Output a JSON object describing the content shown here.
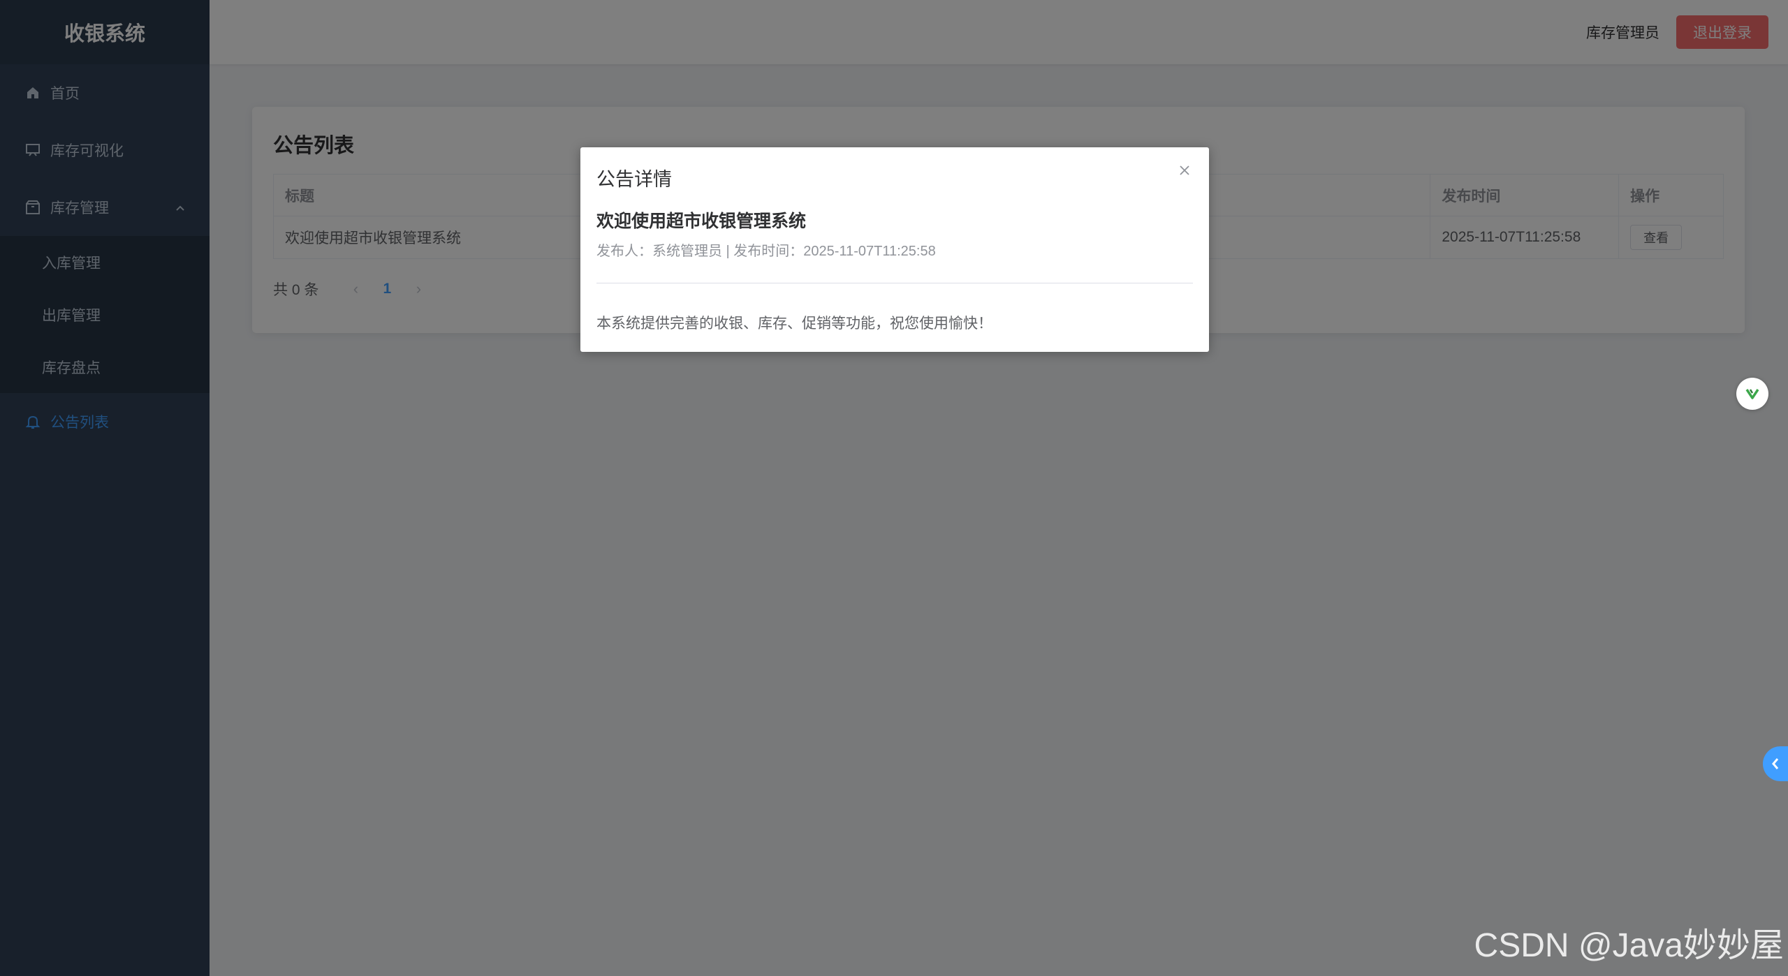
{
  "sidebar": {
    "brand": "收银系统",
    "items": [
      {
        "label": "首页",
        "icon": "home-icon"
      },
      {
        "label": "库存可视化",
        "icon": "chart-board-icon"
      },
      {
        "label": "库存管理",
        "icon": "box-icon",
        "expanded": true
      },
      {
        "label": "入库管理"
      },
      {
        "label": "出库管理"
      },
      {
        "label": "库存盘点"
      },
      {
        "label": "公告列表",
        "icon": "bell-icon",
        "active": true
      }
    ]
  },
  "header": {
    "user": "库存管理员",
    "logout_label": "退出登录"
  },
  "card": {
    "title": "公告列表",
    "columns": [
      "标题",
      "发布时间",
      "操作"
    ],
    "rows": [
      {
        "title": "欢迎使用超市收银管理系统",
        "time": "2025-11-07T11:25:58",
        "action": "查看"
      }
    ],
    "pagination": {
      "total": "共 0 条",
      "current_page": "1"
    }
  },
  "dialog": {
    "title": "公告详情",
    "notice_title": "欢迎使用超市收银管理系统",
    "meta": "发布人：系统管理员 | 发布时间：2025-11-07T11:25:58",
    "content": "本系统提供完善的收银、库存、促销等功能，祝您使用愉快！"
  },
  "colors": {
    "sidebar_bg": "#304156",
    "accent": "#409eff",
    "danger": "#f56c6c"
  },
  "watermark": "CSDN @Java妙妙屋"
}
